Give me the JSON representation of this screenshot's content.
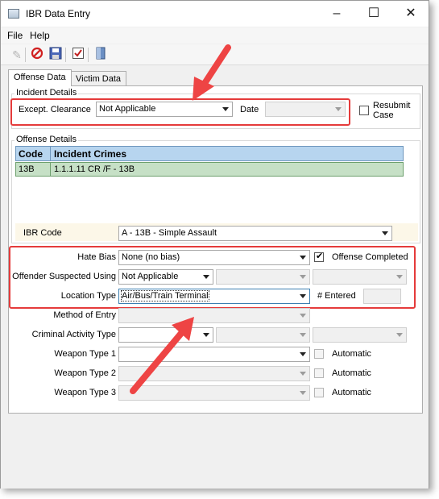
{
  "window": {
    "title": "IBR Data Entry"
  },
  "menu": {
    "file": "File",
    "help": "Help"
  },
  "toolbar": {
    "icons": [
      "pencil-icon",
      "cancel-icon",
      "save-icon",
      "check-form-icon",
      "exit-icon"
    ]
  },
  "tabs": {
    "offense": "Offense Data",
    "victim": "Victim Data"
  },
  "incident": {
    "group_title": "Incident Details",
    "except_label": "Except. Clearance",
    "except_value": "Not Applicable",
    "date_label": "Date",
    "date_value": "",
    "resubmit_label_1": "Resubmit",
    "resubmit_label_2": "Case"
  },
  "offense": {
    "group_title": "Offense Details",
    "columns": {
      "code": "Code",
      "crimes": "Incident Crimes"
    },
    "rows": [
      {
        "code": "13B",
        "crime": "1.1.1.11 CR /F - 13B"
      }
    ],
    "ibr_code_label": "IBR Code",
    "ibr_code_value": "A - 13B - Simple Assault"
  },
  "fields": {
    "hate_bias_label": "Hate Bias",
    "hate_bias_value": "None (no bias)",
    "offense_completed_label": "Offense Completed",
    "offense_completed": true,
    "offender_label": "Offender Suspected Using",
    "offender_value": "Not Applicable",
    "location_label": "Location Type",
    "location_value": "Air/Bus/Train Terminal",
    "entered_label": "# Entered",
    "entered_value": "",
    "method_label": "Method of Entry",
    "criminal_label": "Criminal Activity Type",
    "weapon1_label": "Weapon Type 1",
    "weapon2_label": "Weapon Type 2",
    "weapon3_label": "Weapon Type 3",
    "automatic_label": "Automatic"
  },
  "colors": {
    "highlight": "#e53b3b",
    "grid_header": "#b7d5ef",
    "grid_row": "#c6e0c6"
  }
}
